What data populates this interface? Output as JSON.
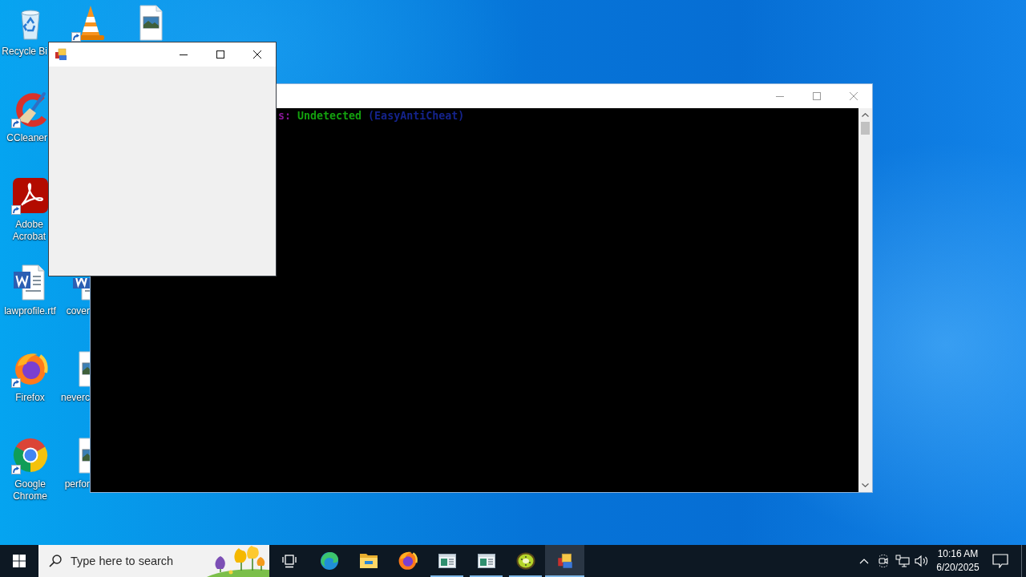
{
  "desktop_icons": [
    {
      "kind": "bin",
      "label": "Recycle Bi",
      "shortcut": false
    },
    {
      "kind": "cone",
      "shortcut": true
    },
    {
      "kind": "picture",
      "shortcut": false
    },
    {
      "kind": "cleaner",
      "label": "CCleaner",
      "shortcut": true
    },
    {
      "kind": "pdf",
      "label": "Adobe Acrobat",
      "shortcut": true
    },
    {
      "kind": "worddoc",
      "label": "lawprofile.rtf",
      "shortcut": false
    },
    {
      "kind": "worddoc",
      "label": "cover",
      "shortcut": false
    },
    {
      "kind": "foxbrowser",
      "label": "Firefox",
      "shortcut": true
    },
    {
      "kind": "picture",
      "label": "neverc",
      "shortcut": false
    },
    {
      "kind": "ringbrowser",
      "label": "Google Chrome",
      "shortcut": true
    },
    {
      "kind": "picture",
      "label": "perfor",
      "shortcut": false
    }
  ],
  "windows": [
    {
      "kind": "console",
      "active": false,
      "lines": [
        {
          "segments": [
            {
              "text": "s:",
              "color": "#881798"
            },
            {
              "text": "Undetected",
              "color": "#13a10e"
            },
            {
              "text": "(EasyAntiCheat)",
              "color": "#14238c"
            }
          ]
        }
      ]
    },
    {
      "kind": "form",
      "active": true
    }
  ],
  "taskbar": {
    "search": {
      "placeholder": "Type here to search"
    },
    "apps": [
      {
        "kind": "taskview",
        "running": false,
        "active": false
      },
      {
        "kind": "wave",
        "running": false,
        "active": false
      },
      {
        "kind": "folder",
        "running": false,
        "active": false
      },
      {
        "kind": "foxbrowser",
        "running": false,
        "active": false
      },
      {
        "kind": "window",
        "running": true,
        "active": false
      },
      {
        "kind": "window",
        "running": true,
        "active": false
      },
      {
        "kind": "kiwi",
        "running": true,
        "active": false
      },
      {
        "kind": "tiles",
        "running": true,
        "active": true
      }
    ],
    "clock": {
      "time": "10:16 AM",
      "date": "6/20/2025"
    }
  }
}
